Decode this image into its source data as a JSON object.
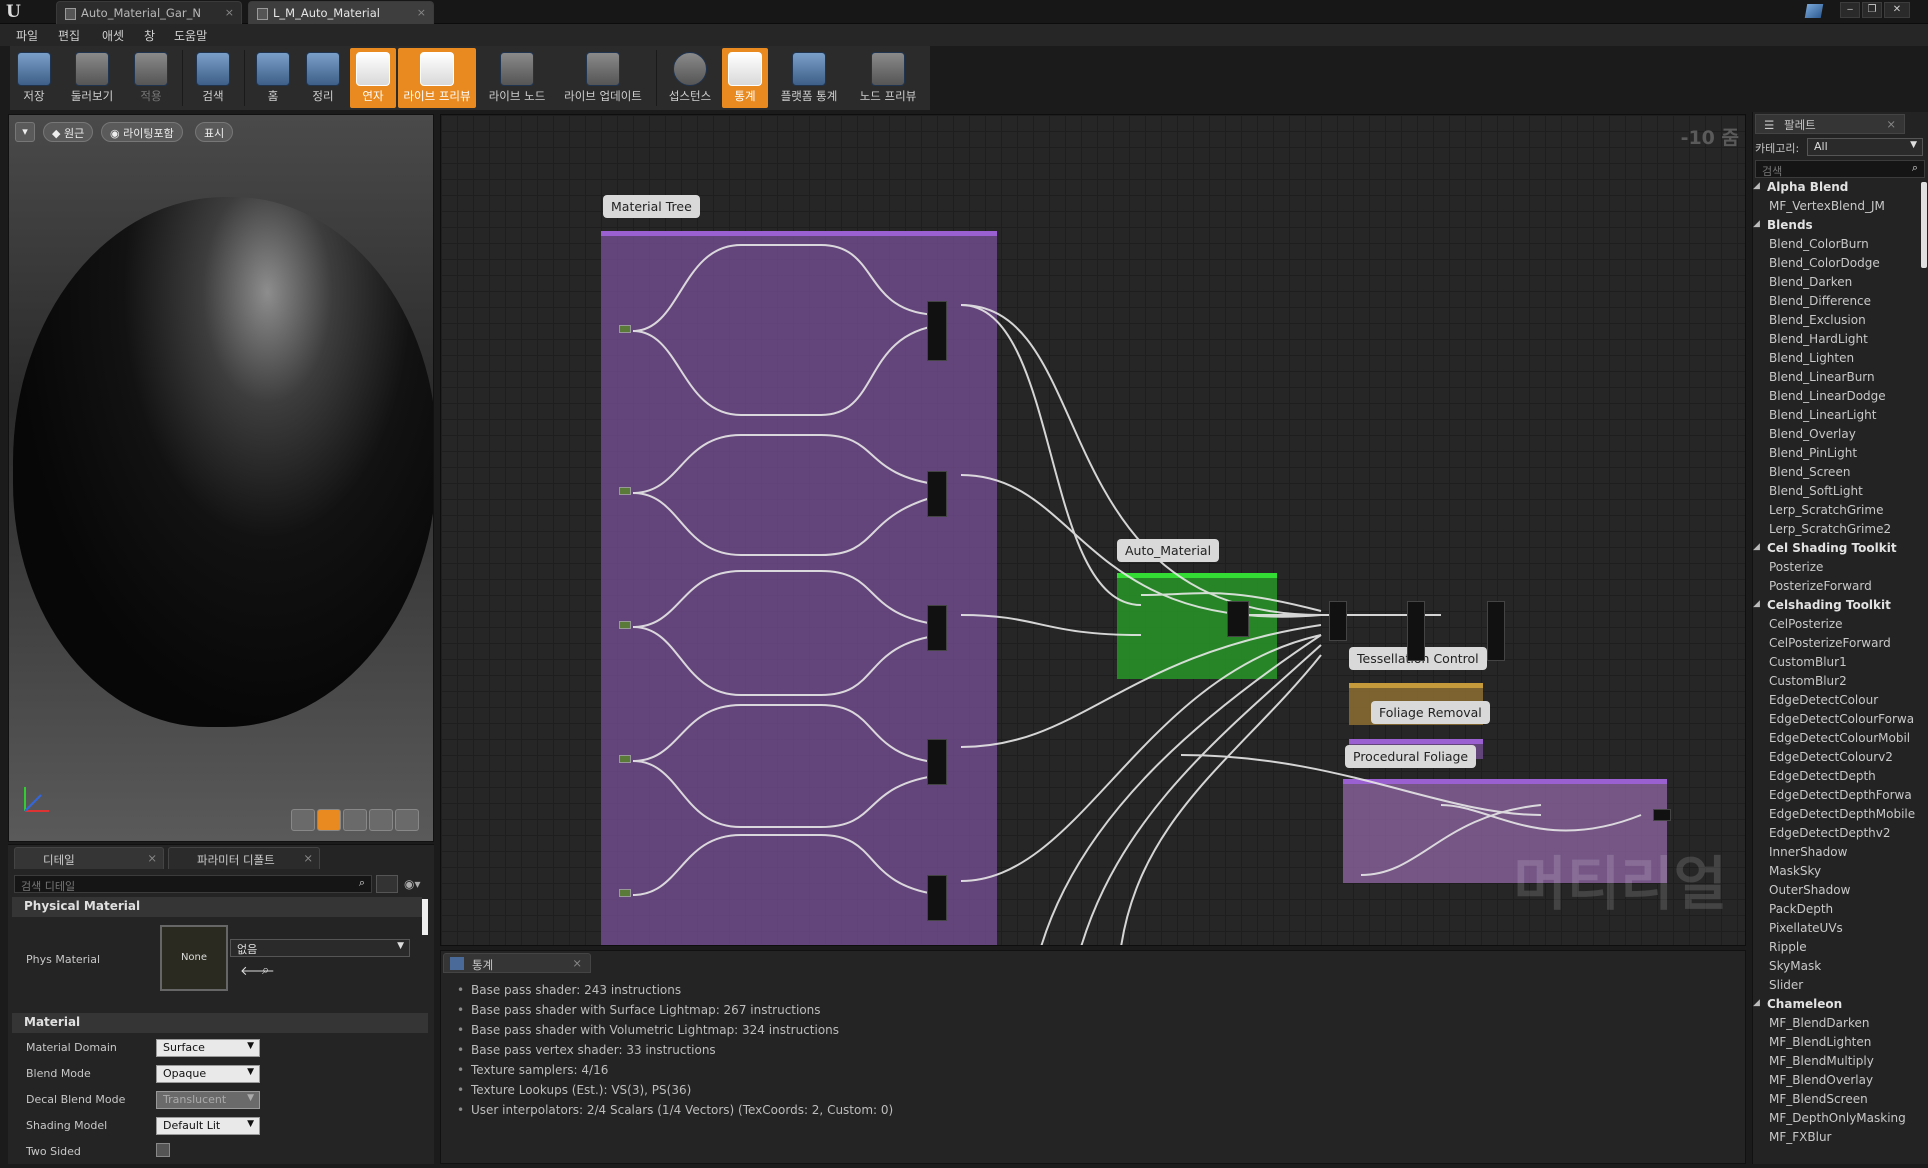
{
  "titlebar": {
    "tabs": [
      {
        "label": "Auto_Material_Gar_N",
        "active": false
      },
      {
        "label": "L_M_Auto_Material",
        "active": true
      }
    ],
    "close_glyph": "×"
  },
  "menu": [
    "파일",
    "편집",
    "애셋",
    "창",
    "도움말"
  ],
  "toolbar": [
    {
      "label": "저장",
      "icon": "save-icon",
      "active": false
    },
    {
      "label": "둘러보기",
      "icon": "browse-icon",
      "active": false
    },
    {
      "label": "적용",
      "icon": "apply-icon",
      "active": false
    },
    {
      "label": "검색",
      "icon": "search-icon",
      "active": false
    },
    {
      "label": "홈",
      "icon": "home-icon",
      "active": false
    },
    {
      "label": "정리",
      "icon": "clean-up-icon",
      "active": false
    },
    {
      "label": "연자",
      "icon": "connectors-icon",
      "active": true
    },
    {
      "label": "라이브 프리뷰",
      "icon": "live-preview-icon",
      "active": true
    },
    {
      "label": "라이브 노드",
      "icon": "live-nodes-icon",
      "active": false
    },
    {
      "label": "라이브 업데이트",
      "icon": "live-update-icon",
      "active": false
    },
    {
      "label": "섭스턴스",
      "icon": "substance-icon",
      "active": false
    },
    {
      "label": "통계",
      "icon": "stats-icon",
      "active": true
    },
    {
      "label": "플랫폼 통계",
      "icon": "platform-stats-icon",
      "active": false
    },
    {
      "label": "노드 프리뷰",
      "icon": "node-preview-icon",
      "active": false
    }
  ],
  "viewport": {
    "buttons": [
      "원근",
      "라이팅포함",
      "표시"
    ]
  },
  "details": {
    "tabs": [
      "디테일",
      "파라미터 디폴트"
    ],
    "search_placeholder": "검색 디테일",
    "physical_material": {
      "header": "Physical Material",
      "label": "Phys Material",
      "thumb": "None",
      "value": "없음"
    },
    "material": {
      "header": "Material",
      "rows": [
        {
          "label": "Material Domain",
          "value": "Surface",
          "enabled": true
        },
        {
          "label": "Blend Mode",
          "value": "Opaque",
          "enabled": true
        },
        {
          "label": "Decal Blend Mode",
          "value": "Translucent",
          "enabled": false
        },
        {
          "label": "Shading Model",
          "value": "Default Lit",
          "enabled": true
        },
        {
          "label": "Two Sided",
          "value": "",
          "enabled": true
        }
      ]
    }
  },
  "graph": {
    "zoom": "-10 줌",
    "watermark": "머티리얼",
    "comments": {
      "material_tree": "Material Tree",
      "auto_material": "Auto_Material",
      "tessellation": "Tessellation Control",
      "foliage_removal": "Foliage Removal",
      "procedural": "Procedural Foliage"
    }
  },
  "stats": {
    "tab": "통계",
    "lines": [
      "Base pass shader: 243 instructions",
      "Base pass shader with Surface Lightmap: 267 instructions",
      "Base pass shader with Volumetric Lightmap: 324 instructions",
      "Base pass vertex shader: 33 instructions",
      "Texture samplers: 4/16",
      "Texture Lookups (Est.): VS(3), PS(36)",
      "User interpolators: 2/4 Scalars (1/4 Vectors) (TexCoords: 2, Custom: 0)"
    ]
  },
  "palette": {
    "title": "팔레트",
    "category_label": "카테고리:",
    "category_value": "All",
    "search_placeholder": "검색",
    "entries": [
      {
        "t": "cat",
        "label": "Alpha Blend"
      },
      {
        "t": "item",
        "label": "MF_VertexBlend_JM"
      },
      {
        "t": "cat",
        "label": "Blends"
      },
      {
        "t": "item",
        "label": "Blend_ColorBurn"
      },
      {
        "t": "item",
        "label": "Blend_ColorDodge"
      },
      {
        "t": "item",
        "label": "Blend_Darken"
      },
      {
        "t": "item",
        "label": "Blend_Difference"
      },
      {
        "t": "item",
        "label": "Blend_Exclusion"
      },
      {
        "t": "item",
        "label": "Blend_HardLight"
      },
      {
        "t": "item",
        "label": "Blend_Lighten"
      },
      {
        "t": "item",
        "label": "Blend_LinearBurn"
      },
      {
        "t": "item",
        "label": "Blend_LinearDodge"
      },
      {
        "t": "item",
        "label": "Blend_LinearLight"
      },
      {
        "t": "item",
        "label": "Blend_Overlay"
      },
      {
        "t": "item",
        "label": "Blend_PinLight"
      },
      {
        "t": "item",
        "label": "Blend_Screen"
      },
      {
        "t": "item",
        "label": "Blend_SoftLight"
      },
      {
        "t": "item",
        "label": "Lerp_ScratchGrime"
      },
      {
        "t": "item",
        "label": "Lerp_ScratchGrime2"
      },
      {
        "t": "cat",
        "label": "Cel Shading Toolkit"
      },
      {
        "t": "item",
        "label": "Posterize"
      },
      {
        "t": "item",
        "label": "PosterizeForward"
      },
      {
        "t": "cat",
        "label": "Celshading Toolkit"
      },
      {
        "t": "item",
        "label": "CelPosterize"
      },
      {
        "t": "item",
        "label": "CelPosterizeForward"
      },
      {
        "t": "item",
        "label": "CustomBlur1"
      },
      {
        "t": "item",
        "label": "CustomBlur2"
      },
      {
        "t": "item",
        "label": "EdgeDetectColour"
      },
      {
        "t": "item",
        "label": "EdgeDetectColourForwa"
      },
      {
        "t": "item",
        "label": "EdgeDetectColourMobil"
      },
      {
        "t": "item",
        "label": "EdgeDetectColourv2"
      },
      {
        "t": "item",
        "label": "EdgeDetectDepth"
      },
      {
        "t": "item",
        "label": "EdgeDetectDepthForwa"
      },
      {
        "t": "item",
        "label": "EdgeDetectDepthMobile"
      },
      {
        "t": "item",
        "label": "EdgeDetectDepthv2"
      },
      {
        "t": "item",
        "label": "InnerShadow"
      },
      {
        "t": "item",
        "label": "MaskSky"
      },
      {
        "t": "item",
        "label": "OuterShadow"
      },
      {
        "t": "item",
        "label": "PackDepth"
      },
      {
        "t": "item",
        "label": "PixellateUVs"
      },
      {
        "t": "item",
        "label": "Ripple"
      },
      {
        "t": "item",
        "label": "SkyMask"
      },
      {
        "t": "item",
        "label": "Slider"
      },
      {
        "t": "cat",
        "label": "Chameleon"
      },
      {
        "t": "item",
        "label": "MF_BlendDarken"
      },
      {
        "t": "item",
        "label": "MF_BlendLighten"
      },
      {
        "t": "item",
        "label": "MF_BlendMultiply"
      },
      {
        "t": "item",
        "label": "MF_BlendOverlay"
      },
      {
        "t": "item",
        "label": "MF_BlendScreen"
      },
      {
        "t": "item",
        "label": "MF_DepthOnlyMasking"
      },
      {
        "t": "item",
        "label": "MF_FXBlur"
      }
    ]
  }
}
